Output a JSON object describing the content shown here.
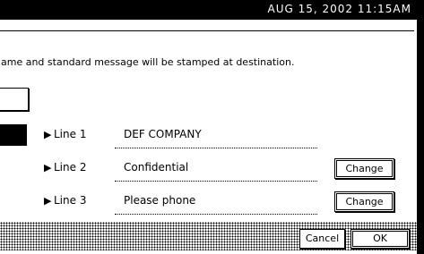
{
  "status": {
    "datetime": "AUG 15, 2002 11:15AM"
  },
  "message": "ame and standard message will be stamped at destination.",
  "lines": [
    {
      "arrow": "▶",
      "label": "Line 1",
      "value": "DEF COMPANY"
    },
    {
      "arrow": "▶",
      "label": "Line 2",
      "value": "Confidential",
      "button": "Change"
    },
    {
      "arrow": "▶",
      "label": "Line 3",
      "value": "Please phone",
      "button": "Change"
    }
  ],
  "footer": {
    "cancel": "Cancel",
    "ok": "OK"
  }
}
